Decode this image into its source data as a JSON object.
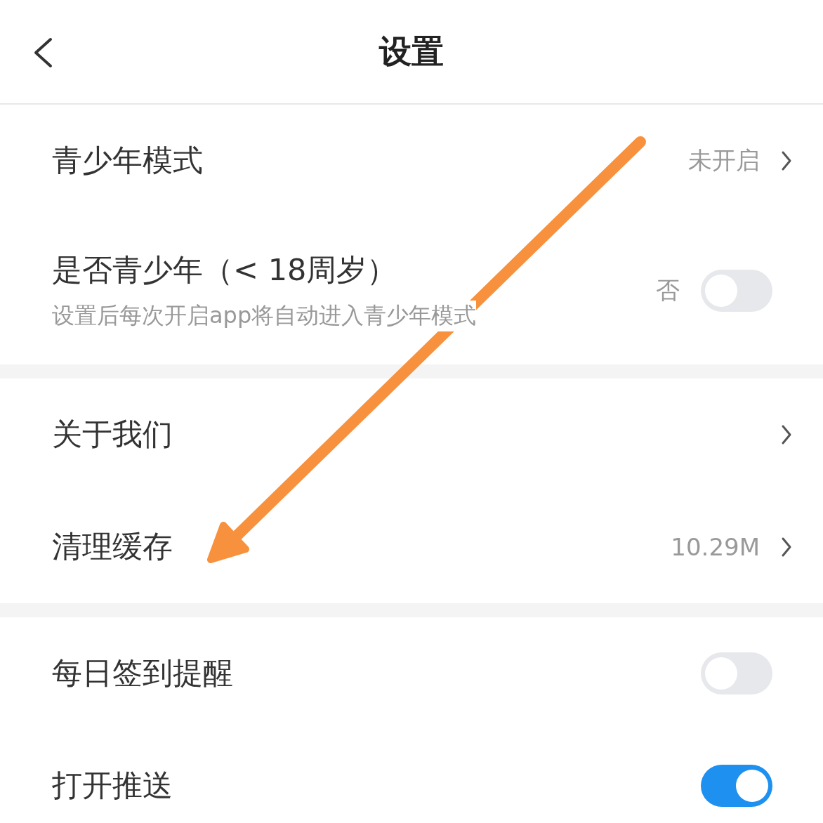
{
  "header": {
    "title": "设置"
  },
  "sections": [
    {
      "rows": [
        {
          "kind": "link",
          "label": "青少年模式",
          "value": "未开启"
        },
        {
          "kind": "toggle",
          "label": "是否青少年（< 18周岁）",
          "subtitle": "设置后每次开启app将自动进入青少年模式",
          "value": "否",
          "on": false
        }
      ]
    },
    {
      "rows": [
        {
          "kind": "link",
          "label": "关于我们"
        },
        {
          "kind": "link",
          "label": "清理缓存",
          "value": "10.29M"
        }
      ]
    },
    {
      "rows": [
        {
          "kind": "toggle",
          "label": "每日签到提醒",
          "on": false
        },
        {
          "kind": "toggle",
          "label": "打开推送",
          "on": true
        }
      ]
    }
  ]
}
